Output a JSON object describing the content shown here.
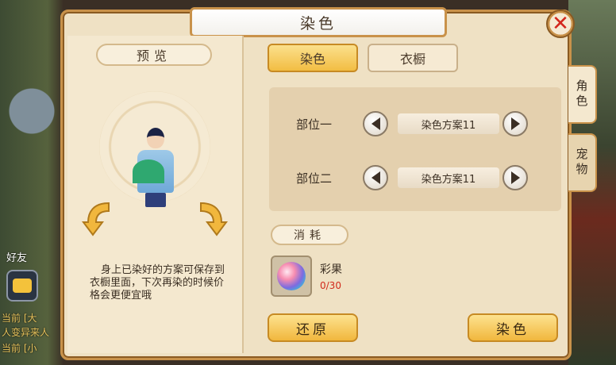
{
  "window": {
    "title": "染色",
    "close_icon": "close-icon"
  },
  "preview": {
    "label": "预览",
    "description": "身上已染好的方案可保存到衣橱里面，下次再染的时候价格会更便宜哦"
  },
  "tabs": [
    {
      "label": "染色",
      "active": true
    },
    {
      "label": "衣橱",
      "active": false
    }
  ],
  "parts": [
    {
      "label": "部位一",
      "scheme": "染色方案11"
    },
    {
      "label": "部位二",
      "scheme": "染色方案11"
    }
  ],
  "cost": {
    "label": "消耗",
    "item_name": "彩果",
    "item_count": "0/30",
    "item_icon": "rainbow-fruit-icon"
  },
  "actions": {
    "restore_label": "还原",
    "dye_label": "染色"
  },
  "side_tabs": [
    {
      "label": "角色",
      "active": true
    },
    {
      "label": "宠物",
      "active": false
    }
  ],
  "hud": {
    "friend_label": "好友",
    "chat_lines": [
      "当前 [大",
      "人变异来人",
      "当前 [小"
    ]
  },
  "colors": {
    "accent_gold": "#f2bd43",
    "panel_bg": "#efe1c4",
    "count_red": "#d12a1c"
  }
}
